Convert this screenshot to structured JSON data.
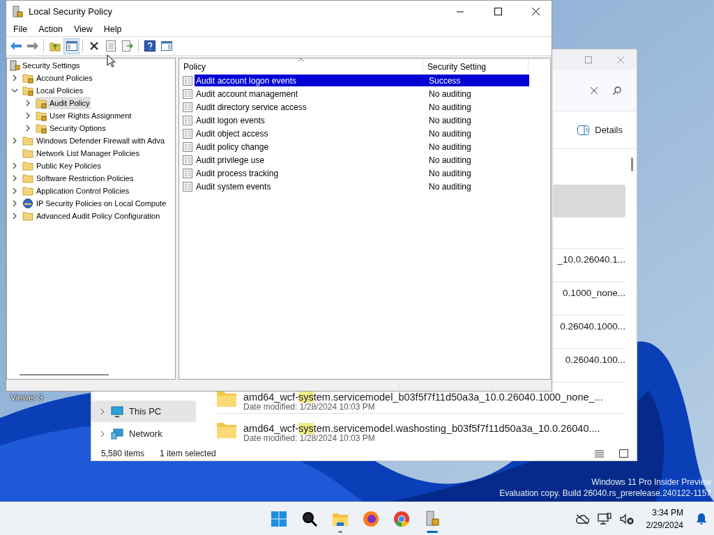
{
  "desktop": {
    "icon_label": "Viewer 3",
    "watermark": [
      "Windows 11 Pro Insider Preview",
      "Evaluation copy. Build 26040.rs_prerelease.240122-1157"
    ]
  },
  "explorer": {
    "command_bar": {
      "details": "Details"
    },
    "nav": [
      {
        "label": "This PC",
        "kind": "pc",
        "selected": true
      },
      {
        "label": "Network",
        "kind": "network",
        "selected": false
      }
    ],
    "rows": [
      {
        "selected": true
      },
      {
        "fragment": "_10.0.26040.1...",
        "selected": false
      },
      {
        "fragment": "0.1000_none...",
        "selected": false
      },
      {
        "fragment": "0.26040.1000...",
        "selected": false
      },
      {
        "fragment": "0.26040.100...",
        "selected": false
      },
      {
        "name": [
          "amd64_wcf-",
          "sys",
          "tem.servicemodel_b03f5f7f11d50a3a_10.0.26040.1000_none_..."
        ],
        "date_label": "Date modified:",
        "date": "1/28/2024 10:03 PM",
        "selected": false
      },
      {
        "name": [
          "amd64_wcf-",
          "sys",
          "tem.servicemodel.washosting_b03f5f7f11d50a3a_10.0.26040...."
        ],
        "date_label": "Date modified:",
        "date": "1/28/2024 10:03 PM",
        "selected": false
      }
    ],
    "status": {
      "count": "5,580 items",
      "selection": "1 item selected"
    }
  },
  "lsp": {
    "title": "Local Security Policy",
    "menu": [
      "File",
      "Action",
      "View",
      "Help"
    ],
    "tree": [
      {
        "label": "Security Settings",
        "kind": "root",
        "selected": false,
        "children": [
          {
            "label": "Account Policies",
            "kind": "lock-folder",
            "expandable": true,
            "expanded": false,
            "selected": false
          },
          {
            "label": "Local Policies",
            "kind": "lock-folder",
            "expandable": true,
            "expanded": true,
            "selected": false,
            "children": [
              {
                "label": "Audit Policy",
                "kind": "lock-folder",
                "expandable": true,
                "expanded": false,
                "selected": true
              },
              {
                "label": "User Rights Assignment",
                "kind": "lock-folder",
                "expandable": true,
                "expanded": false,
                "selected": false
              },
              {
                "label": "Security Options",
                "kind": "lock-folder",
                "expandable": true,
                "expanded": false,
                "selected": false
              }
            ]
          },
          {
            "label": "Windows Defender Firewall with Adva",
            "kind": "folder",
            "expandable": true,
            "expanded": false,
            "selected": false
          },
          {
            "label": "Network List Manager Policies",
            "kind": "folder",
            "expandable": false,
            "selected": false
          },
          {
            "label": "Public Key Policies",
            "kind": "folder",
            "expandable": true,
            "expanded": false,
            "selected": false
          },
          {
            "label": "Software Restriction Policies",
            "kind": "folder",
            "expandable": true,
            "expanded": false,
            "selected": false
          },
          {
            "label": "Application Control Policies",
            "kind": "folder",
            "expandable": true,
            "expanded": false,
            "selected": false
          },
          {
            "label": "IP Security Policies on Local Compute",
            "kind": "ip",
            "expandable": true,
            "expanded": false,
            "selected": false
          },
          {
            "label": "Advanced Audit Policy Configuration",
            "kind": "folder",
            "expandable": true,
            "expanded": false,
            "selected": false
          }
        ]
      }
    ],
    "columns": [
      "Policy",
      "Security Setting"
    ],
    "policies": [
      {
        "policy": "Audit account logon events",
        "setting": "Success",
        "selected": true
      },
      {
        "policy": "Audit account management",
        "setting": "No auditing",
        "selected": false
      },
      {
        "policy": "Audit directory service access",
        "setting": "No auditing",
        "selected": false
      },
      {
        "policy": "Audit logon events",
        "setting": "No auditing",
        "selected": false
      },
      {
        "policy": "Audit object access",
        "setting": "No auditing",
        "selected": false
      },
      {
        "policy": "Audit policy change",
        "setting": "No auditing",
        "selected": false
      },
      {
        "policy": "Audit privilege use",
        "setting": "No auditing",
        "selected": false
      },
      {
        "policy": "Audit process tracking",
        "setting": "No auditing",
        "selected": false
      },
      {
        "policy": "Audit system events",
        "setting": "No auditing",
        "selected": false
      }
    ]
  },
  "taskbar": {
    "apps": [
      {
        "kind": "start",
        "running": false
      },
      {
        "kind": "search",
        "running": false
      },
      {
        "kind": "explorer",
        "running": true
      },
      {
        "kind": "firefox",
        "running": false
      },
      {
        "kind": "chrome",
        "running": false
      },
      {
        "kind": "security-policy",
        "running": true,
        "active": true
      }
    ],
    "time": "3:34 PM",
    "date": "2/29/2024"
  }
}
